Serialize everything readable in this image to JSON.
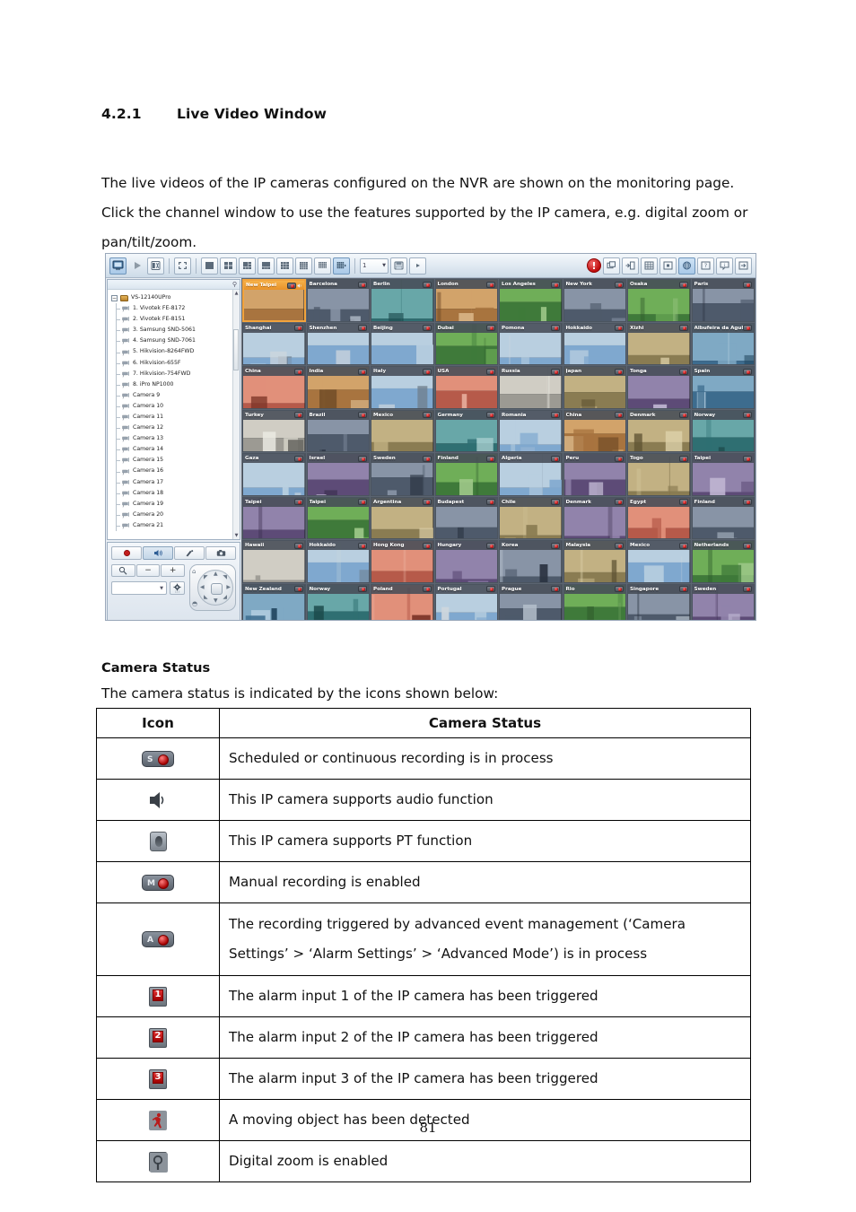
{
  "document": {
    "heading_number": "4.2.1",
    "heading_title": "Live Video Window",
    "paragraph": "The live videos of the IP cameras configured on the NVR are shown on the monitoring page. Click the channel window to use the features supported by the IP camera, e.g. digital zoom or pan/tilt/zoom.",
    "page_number": "81"
  },
  "camera_status_section": {
    "title": "Camera Status",
    "subtitle": "The camera status is indicated by the icons shown below:",
    "columns": [
      "Icon",
      "Camera Status"
    ],
    "rows": [
      {
        "icon": "scheduled-recording-icon",
        "icon_letter": "S",
        "description": "Scheduled or continuous recording is in process"
      },
      {
        "icon": "audio-supported-icon",
        "icon_letter": "",
        "description": "This IP camera supports audio function"
      },
      {
        "icon": "pt-supported-icon",
        "icon_letter": "",
        "description": "This IP camera supports PT function"
      },
      {
        "icon": "manual-recording-icon",
        "icon_letter": "M",
        "description": "Manual recording is enabled"
      },
      {
        "icon": "advanced-event-recording-icon",
        "icon_letter": "A",
        "description": "The recording triggered by advanced event management (‘Camera Settings’ > ‘Alarm Settings’ > ‘Advanced Mode’) is in process"
      },
      {
        "icon": "alarm-input-1-icon",
        "icon_letter": "1",
        "description": "The alarm input 1 of the IP camera has been triggered"
      },
      {
        "icon": "alarm-input-2-icon",
        "icon_letter": "2",
        "description": "The alarm input 2 of the IP camera has been triggered"
      },
      {
        "icon": "alarm-input-3-icon",
        "icon_letter": "3",
        "description": "The alarm input 3 of the IP camera has been triggered"
      },
      {
        "icon": "motion-detected-icon",
        "icon_letter": "",
        "description": "A moving object has been detected"
      },
      {
        "icon": "digital-zoom-icon",
        "icon_letter": "",
        "description": "Digital zoom is enabled"
      }
    ]
  },
  "nvr_app": {
    "toolbar": {
      "left_buttons": [
        {
          "name": "monitor-mode-button",
          "active": true
        },
        {
          "name": "playback-button",
          "active": false
        },
        {
          "name": "settings-button",
          "active": false
        }
      ],
      "layout_buttons": [
        {
          "name": "fullscreen-button",
          "active": false
        },
        {
          "name": "layout-1x1-button",
          "active": false
        },
        {
          "name": "layout-2x2-button",
          "active": false
        },
        {
          "name": "layout-1plus5-button",
          "active": false
        },
        {
          "name": "layout-1plus7-button",
          "active": false
        },
        {
          "name": "layout-3x3-button",
          "active": false
        },
        {
          "name": "layout-4x4-button",
          "active": false
        },
        {
          "name": "layout-5x5-button",
          "active": false
        },
        {
          "name": "layout-multi-button",
          "active": true
        }
      ],
      "page_selector_value": "1",
      "snapshot_button": "snapshot-button",
      "more_button": "more-button",
      "right_buttons": [
        {
          "name": "alert-indicator-icon"
        },
        {
          "name": "multi-window-button"
        },
        {
          "name": "auto-cruise-button"
        },
        {
          "name": "layout-config-button"
        },
        {
          "name": "single-view-button"
        },
        {
          "name": "e-map-button"
        },
        {
          "name": "help-button"
        },
        {
          "name": "about-button"
        },
        {
          "name": "logout-button"
        }
      ]
    },
    "tree": {
      "root": "VS-12140UPro",
      "items": [
        "1. Vivotek FE-8172",
        "2. Vivotek FE-8151",
        "3. Samsung SND-5061",
        "4. Samsung SND-7061",
        "5. Hikvision-8264FWD",
        "6. Hikvision-655F",
        "7. Hikvision-754FWD",
        "8. iPro NP1000",
        "Camera 9",
        "Camera 10",
        "Camera 11",
        "Camera 12",
        "Camera 13",
        "Camera 14",
        "Camera 15",
        "Camera 16",
        "Camera 17",
        "Camera 18",
        "Camera 19",
        "Camera 20",
        "Camera 21"
      ]
    },
    "ptz_panel": {
      "tabs": [
        {
          "name": "manual-record-button",
          "active": false
        },
        {
          "name": "audio-button",
          "active": true
        },
        {
          "name": "talk-button",
          "active": false
        },
        {
          "name": "snapshot-button",
          "active": false
        }
      ],
      "zoom_buttons": [
        {
          "name": "digital-zoom-button",
          "label": ""
        },
        {
          "name": "zoom-out-button",
          "label": "−"
        },
        {
          "name": "zoom-in-button",
          "label": "+"
        }
      ],
      "preset_select_value": "",
      "settings_button": "ptz-settings-button"
    },
    "video_grid": {
      "selected_channel": "New Taipei",
      "channels": [
        {
          "title": "New Taipei",
          "selected": true,
          "audio": true,
          "img": "b1"
        },
        {
          "title": "Barcelona",
          "selected": false,
          "audio": false,
          "img": "b2"
        },
        {
          "title": "Berlin",
          "selected": false,
          "audio": false,
          "img": "b3"
        },
        {
          "title": "London",
          "selected": false,
          "audio": false,
          "img": "b4"
        },
        {
          "title": "Los Angeles",
          "selected": false,
          "audio": false,
          "img": "b5"
        },
        {
          "title": "New York",
          "selected": false,
          "audio": false,
          "img": "b6"
        },
        {
          "title": "Osaka",
          "selected": false,
          "audio": false,
          "img": "b7"
        },
        {
          "title": "Paris",
          "selected": false,
          "audio": false,
          "img": "b8"
        },
        {
          "title": "Shanghai",
          "selected": false,
          "audio": false,
          "img": "c1"
        },
        {
          "title": "Shenzhen",
          "selected": false,
          "audio": false,
          "img": "c2"
        },
        {
          "title": "Beijing",
          "selected": false,
          "audio": false,
          "img": "c3"
        },
        {
          "title": "Dubai",
          "selected": false,
          "audio": false,
          "img": "c4"
        },
        {
          "title": "Pomona",
          "selected": false,
          "audio": false,
          "img": "c5"
        },
        {
          "title": "Hokkaido",
          "selected": false,
          "audio": false,
          "img": "c6"
        },
        {
          "title": "Xizhi",
          "selected": false,
          "audio": false,
          "img": "c7"
        },
        {
          "title": "Albufeira da Agulera",
          "selected": false,
          "audio": false,
          "img": "c8"
        },
        {
          "title": "China",
          "selected": false,
          "audio": false,
          "img": "d1"
        },
        {
          "title": "India",
          "selected": false,
          "audio": false,
          "img": "d2"
        },
        {
          "title": "Italy",
          "selected": false,
          "audio": false,
          "img": "d3"
        },
        {
          "title": "USA",
          "selected": false,
          "audio": false,
          "img": "d4"
        },
        {
          "title": "Russia",
          "selected": false,
          "audio": false,
          "img": "d5"
        },
        {
          "title": "Japan",
          "selected": false,
          "audio": false,
          "img": "d6"
        },
        {
          "title": "Tonga",
          "selected": false,
          "audio": false,
          "img": "d7"
        },
        {
          "title": "Spain",
          "selected": false,
          "audio": false,
          "img": "d8"
        },
        {
          "title": "Turkey",
          "selected": false,
          "audio": false,
          "img": "e1"
        },
        {
          "title": "Brazil",
          "selected": false,
          "audio": false,
          "img": "e2"
        },
        {
          "title": "Mexico",
          "selected": false,
          "audio": false,
          "img": "e3"
        },
        {
          "title": "Germany",
          "selected": false,
          "audio": false,
          "img": "e4"
        },
        {
          "title": "Romania",
          "selected": false,
          "audio": false,
          "img": "e5"
        },
        {
          "title": "China",
          "selected": false,
          "audio": false,
          "img": "e6"
        },
        {
          "title": "Denmark",
          "selected": false,
          "audio": false,
          "img": "e7"
        },
        {
          "title": "Norway",
          "selected": false,
          "audio": false,
          "img": "e8"
        },
        {
          "title": "Gaza",
          "selected": false,
          "audio": false,
          "img": "f1"
        },
        {
          "title": "Israel",
          "selected": false,
          "audio": false,
          "img": "f2"
        },
        {
          "title": "Sweden",
          "selected": false,
          "audio": false,
          "img": "f3"
        },
        {
          "title": "Finland",
          "selected": false,
          "audio": false,
          "img": "f4"
        },
        {
          "title": "Algeria",
          "selected": false,
          "audio": false,
          "img": "f5"
        },
        {
          "title": "Peru",
          "selected": false,
          "audio": false,
          "img": "f6"
        },
        {
          "title": "Togo",
          "selected": false,
          "audio": false,
          "img": "f7"
        },
        {
          "title": "Taipei",
          "selected": false,
          "audio": false,
          "img": "f8"
        },
        {
          "title": "Taipei",
          "selected": false,
          "audio": false,
          "img": "g1"
        },
        {
          "title": "Taipei",
          "selected": false,
          "audio": false,
          "img": "g2"
        },
        {
          "title": "Argentina",
          "selected": false,
          "audio": false,
          "img": "g3"
        },
        {
          "title": "Budapest",
          "selected": false,
          "audio": false,
          "img": "g4"
        },
        {
          "title": "Chile",
          "selected": false,
          "audio": false,
          "img": "g5"
        },
        {
          "title": "Denmark",
          "selected": false,
          "audio": false,
          "img": "g6"
        },
        {
          "title": "Egypt",
          "selected": false,
          "audio": false,
          "img": "g7"
        },
        {
          "title": "Finland",
          "selected": false,
          "audio": false,
          "img": "g8"
        },
        {
          "title": "Hawaii",
          "selected": false,
          "audio": false,
          "img": "h1"
        },
        {
          "title": "Hokkaido",
          "selected": false,
          "audio": false,
          "img": "h2"
        },
        {
          "title": "Hong Kong",
          "selected": false,
          "audio": false,
          "img": "h3"
        },
        {
          "title": "Hungary",
          "selected": false,
          "audio": false,
          "img": "h4"
        },
        {
          "title": "Korea",
          "selected": false,
          "audio": false,
          "img": "h5"
        },
        {
          "title": "Malaysia",
          "selected": false,
          "audio": false,
          "img": "h6"
        },
        {
          "title": "Mexico",
          "selected": false,
          "audio": false,
          "img": "h7"
        },
        {
          "title": "Netherlands",
          "selected": false,
          "audio": false,
          "img": "h8"
        },
        {
          "title": "New Zealand",
          "selected": false,
          "audio": false,
          "img": "i1"
        },
        {
          "title": "Norway",
          "selected": false,
          "audio": false,
          "img": "i2"
        },
        {
          "title": "Poland",
          "selected": false,
          "audio": false,
          "img": "i3"
        },
        {
          "title": "Portugal",
          "selected": false,
          "audio": false,
          "img": "i4"
        },
        {
          "title": "Prague",
          "selected": false,
          "audio": false,
          "img": "i5"
        },
        {
          "title": "Rio",
          "selected": false,
          "audio": false,
          "img": "i6"
        },
        {
          "title": "Singapore",
          "selected": false,
          "audio": false,
          "img": "i7"
        },
        {
          "title": "Sweden",
          "selected": false,
          "audio": false,
          "img": "i8"
        }
      ]
    }
  },
  "colors": {
    "selected_header": "#ee9a2d",
    "cell_header": "#464c56",
    "record_red": "#b00000",
    "alert_red": "#c00d0d"
  }
}
